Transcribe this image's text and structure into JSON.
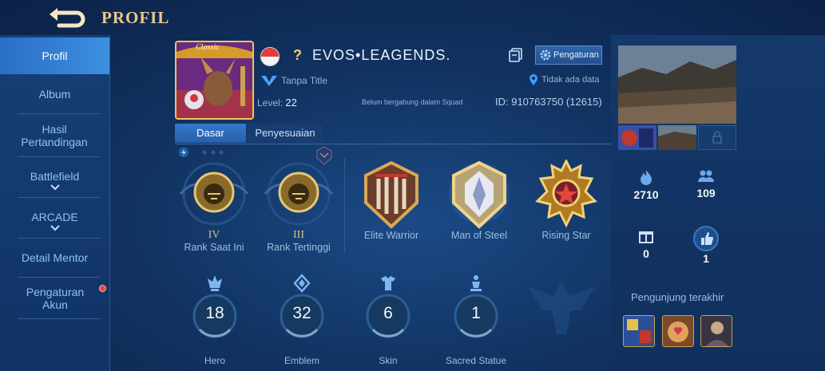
{
  "header": {
    "title": "PROFIL"
  },
  "sidebar": {
    "items": [
      {
        "label": "Profil",
        "active": true
      },
      {
        "label": "Album"
      },
      {
        "label": "Hasil Pertandingan"
      },
      {
        "label": "Battlefield"
      },
      {
        "label": "ARCADE"
      },
      {
        "label": "Detail Mentor"
      },
      {
        "label": "Pengaturan Akun"
      }
    ]
  },
  "profile": {
    "name_prefix": "?",
    "name": "EVOS•LEAGENDS.",
    "title": "Tanpa Title",
    "level_label": "Level:",
    "level": "22",
    "squad": "Belum bergabung dalam Squad",
    "id": "ID: 910763750 (12615)",
    "location": "Tidak ada data",
    "settings_label": "Pengaturan",
    "avatar_banner": "Classic"
  },
  "tabs": [
    {
      "label": "Dasar",
      "active": true
    },
    {
      "label": "Penyesuaian"
    }
  ],
  "medals": [
    {
      "roman": "IV",
      "label": "Rank Saat Ini"
    },
    {
      "roman": "III",
      "label": "Rank Tertinggi"
    },
    {
      "label": "Elite Warrior"
    },
    {
      "label": "Man of Steel"
    },
    {
      "label": "Rising Star"
    }
  ],
  "stats": [
    {
      "value": "18",
      "label": "Hero",
      "icon": "hero-icon"
    },
    {
      "value": "32",
      "label": "Emblem",
      "icon": "emblem-icon"
    },
    {
      "value": "6",
      "label": "Skin",
      "icon": "skin-icon"
    },
    {
      "value": "1",
      "label": "Sacred Statue",
      "icon": "statue-icon"
    }
  ],
  "right": {
    "popularity": "2710",
    "followers": "109",
    "gifts": "0",
    "likes": "1",
    "visitors_title": "Pengunjung terakhir"
  },
  "colors": {
    "accent": "#3379cc",
    "gold": "#e9c98d",
    "label": "#9dbde0"
  }
}
